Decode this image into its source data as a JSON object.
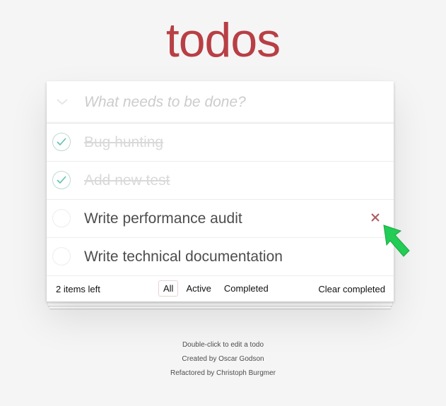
{
  "title": "todos",
  "new_todo": {
    "placeholder": "What needs to be done?"
  },
  "todos": [
    {
      "label": "Bug hunting",
      "completed": true
    },
    {
      "label": "Add new test",
      "completed": true
    },
    {
      "label": "Write performance audit",
      "completed": false
    },
    {
      "label": "Write technical documentation",
      "completed": false
    }
  ],
  "footer": {
    "count": "2 items left",
    "filters": [
      "All",
      "Active",
      "Completed"
    ],
    "selected_filter": "All",
    "clear": "Clear completed"
  },
  "info": {
    "edit_hint": "Double-click to edit a todo",
    "created": "Created by Oscar Godson",
    "refactored": "Refactored by Christoph Burgmer"
  },
  "colors": {
    "title": "#b83f45",
    "check": "#5dc2af",
    "destroy": "#af5b5e",
    "annotation_arrow": "#22cc55"
  },
  "icons": {
    "toggle_all": "chevron-down-icon",
    "complete": "checkmark-icon",
    "destroy": "close-icon",
    "annotation": "arrow-pointer-icon"
  }
}
